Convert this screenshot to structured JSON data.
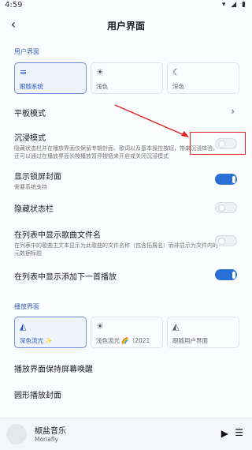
{
  "status": {
    "time": "4:59",
    "icons": "▾ ◢ ▮"
  },
  "appbar": {
    "title": "用户界面"
  },
  "sections": {
    "ui": "用户界面",
    "player": "播放界面"
  },
  "theme_cards": [
    {
      "icon": "≡",
      "label": "跟随系统"
    },
    {
      "icon": "☀",
      "label": "浅色"
    },
    {
      "icon": "☾",
      "label": "深色"
    }
  ],
  "rows": {
    "tablet": {
      "title": "平板模式"
    },
    "immersive": {
      "title": "沉浸模式",
      "desc": "隐藏状态栏并在播放界面仅保留专辑封面、歌词以及基本操控按钮，带来沉浸体验。还可以通过在播放界面长按播放暂停按钮来开启或关闭沉浸模式"
    },
    "lock_cover": {
      "title": "显示锁屏封面",
      "desc": "需要系统支持"
    },
    "hide_status": {
      "title": "隐藏状态栏"
    },
    "show_filename": {
      "title": "在列表中显示歌曲文件名",
      "desc": "在列表中的歌曲主文本显示为此歌曲的文件名称（包含拓展名）而非显示为文件内的元数据标题"
    },
    "add_next": {
      "title": "在列表中显示添加下一首播放"
    },
    "keep_awake": {
      "title": "播放界面保持屏幕唤醒"
    },
    "round_cover": {
      "title": "圆形播放封面"
    }
  },
  "toggles": {
    "immersive": "off",
    "lock_cover": "on",
    "hide_status": "off",
    "show_filename": "off",
    "add_next": "on"
  },
  "player_cards": [
    {
      "icon": "◭",
      "label": "深色流光 ✨"
    },
    {
      "icon": "☀",
      "label": "浅色流光 🌈（2021"
    },
    {
      "icon": "◭",
      "label": "跟随用户界面"
    }
  ],
  "miniplayer": {
    "title": "椒盐音乐",
    "artist": "Moriafly",
    "play_icon": "▶",
    "queue_icon": "☰"
  },
  "colors": {
    "accent": "#2a6fd6",
    "highlight": "#e02020"
  }
}
